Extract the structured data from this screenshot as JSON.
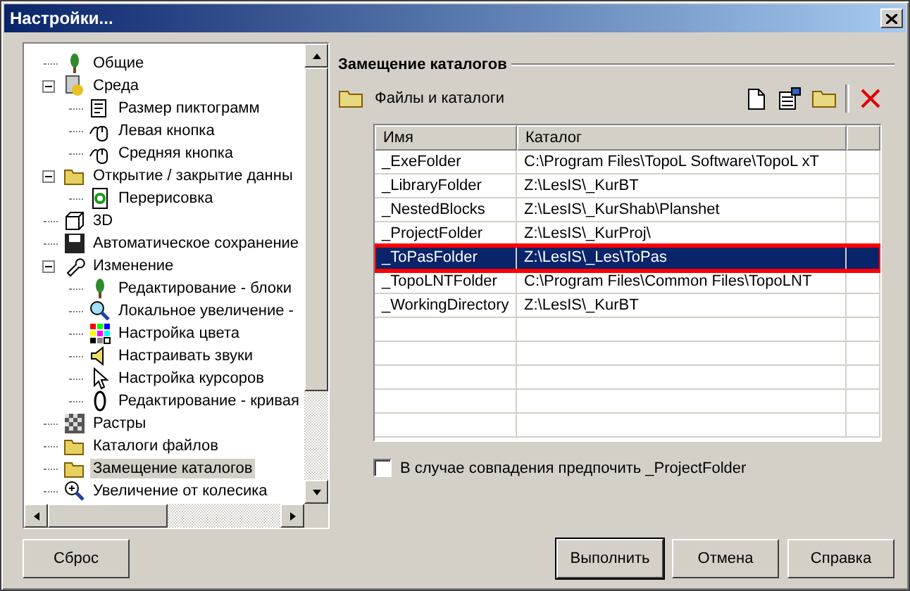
{
  "window": {
    "title": "Настройки..."
  },
  "tree": [
    {
      "label": "Общие",
      "selected": false
    },
    {
      "label": "Среда",
      "selected": false,
      "expanded": true,
      "children": [
        {
          "label": "Размер пиктограмм",
          "selected": false
        },
        {
          "label": "Левая кнопка",
          "selected": false
        },
        {
          "label": "Средняя кнопка",
          "selected": false
        }
      ]
    },
    {
      "label": "Открытие / закрытие данны",
      "selected": false,
      "expanded": true,
      "children": [
        {
          "label": "Перерисовка",
          "selected": false
        }
      ]
    },
    {
      "label": "3D",
      "selected": false
    },
    {
      "label": "Автоматическое сохранение",
      "selected": false
    },
    {
      "label": "Изменение",
      "selected": false,
      "expanded": true,
      "children": [
        {
          "label": "Редактирование - блоки",
          "selected": false
        },
        {
          "label": "Локальное увеличение -",
          "selected": false
        },
        {
          "label": "Настройка цвета",
          "selected": false
        },
        {
          "label": "Настраивать звуки",
          "selected": false
        },
        {
          "label": "Настройка курсоров",
          "selected": false
        },
        {
          "label": "Редактирование - кривая",
          "selected": false
        }
      ]
    },
    {
      "label": "Растры",
      "selected": false
    },
    {
      "label": "Каталоги файлов",
      "selected": false
    },
    {
      "label": "Замещение каталогов",
      "selected": true
    },
    {
      "label": "Увеличение от колесика",
      "selected": false
    }
  ],
  "panel": {
    "title": "Замещение каталогов",
    "subtitle": "Файлы и каталоги",
    "table": {
      "columns": [
        "Имя",
        "Каталог"
      ],
      "rows": [
        {
          "name": "_ExeFolder",
          "catalog": "C:\\Program Files\\TopoL Software\\TopoL xT",
          "selected": false
        },
        {
          "name": "_LibraryFolder",
          "catalog": "Z:\\LesIS\\_KurBT",
          "selected": false
        },
        {
          "name": "_NestedBlocks",
          "catalog": "Z:\\LesIS\\_KurShab\\Planshet",
          "selected": false
        },
        {
          "name": "_ProjectFolder",
          "catalog": "Z:\\LesIS\\_KurProj\\",
          "selected": false
        },
        {
          "name": "_ToPasFolder",
          "catalog": "Z:\\LesIS\\_Les\\ToPas",
          "selected": true
        },
        {
          "name": "_TopoLNTFolder",
          "catalog": "C:\\Program Files\\Common Files\\TopoLNT",
          "selected": false
        },
        {
          "name": "_WorkingDirectory",
          "catalog": "Z:\\LesIS\\_KurBT",
          "selected": false
        }
      ]
    },
    "checkbox": {
      "label": "В случае совпадения предпочить _ProjectFolder",
      "checked": false
    }
  },
  "buttons": [
    {
      "label": "Сброс",
      "default": false
    },
    {
      "label": "Выполнить",
      "default": true
    },
    {
      "label": "Отмена",
      "default": false
    },
    {
      "label": "Справка",
      "default": false
    }
  ]
}
